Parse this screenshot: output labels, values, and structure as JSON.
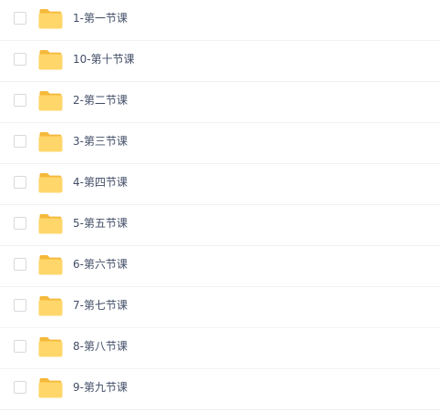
{
  "file_list": {
    "items": [
      {
        "name": "1-第一节课",
        "type": "folder",
        "checked": false
      },
      {
        "name": "10-第十节课",
        "type": "folder",
        "checked": false
      },
      {
        "name": "2-第二节课",
        "type": "folder",
        "checked": false
      },
      {
        "name": "3-第三节课",
        "type": "folder",
        "checked": false
      },
      {
        "name": "4-第四节课",
        "type": "folder",
        "checked": false
      },
      {
        "name": "5-第五节课",
        "type": "folder",
        "checked": false
      },
      {
        "name": "6-第六节课",
        "type": "folder",
        "checked": false
      },
      {
        "name": "7-第七节课",
        "type": "folder",
        "checked": false
      },
      {
        "name": "8-第八节课",
        "type": "folder",
        "checked": false
      },
      {
        "name": "9-第九节课",
        "type": "folder",
        "checked": false
      }
    ],
    "folder_icon": "folder-icon",
    "colors": {
      "folder_back": "#f5b93a",
      "folder_front": "#ffd66a",
      "text": "#424e67",
      "divider": "#f1f2f4",
      "checkbox_border": "#d6d9dd"
    }
  }
}
